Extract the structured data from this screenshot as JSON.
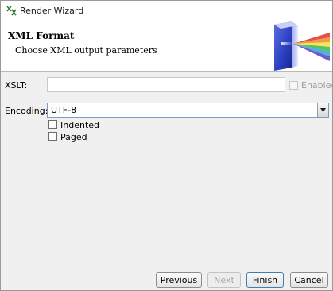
{
  "window": {
    "title": "Render Wizard"
  },
  "header": {
    "title": "XML Format",
    "subtitle": "Choose XML output parameters"
  },
  "form": {
    "xslt_label": "XSLT:",
    "xslt_value": "",
    "enabled_label": "Enabled",
    "encoding_label": "Encoding:",
    "encoding_value": "UTF-8",
    "indented_label": "Indented",
    "paged_label": "Paged"
  },
  "buttons": {
    "previous": "Previous",
    "next": "Next",
    "finish": "Finish",
    "cancel": "Cancel"
  },
  "icons": {
    "app": "app-icon",
    "header_graphic": "xml-prism-graphic",
    "combo_arrow": "chevron-down-icon"
  }
}
